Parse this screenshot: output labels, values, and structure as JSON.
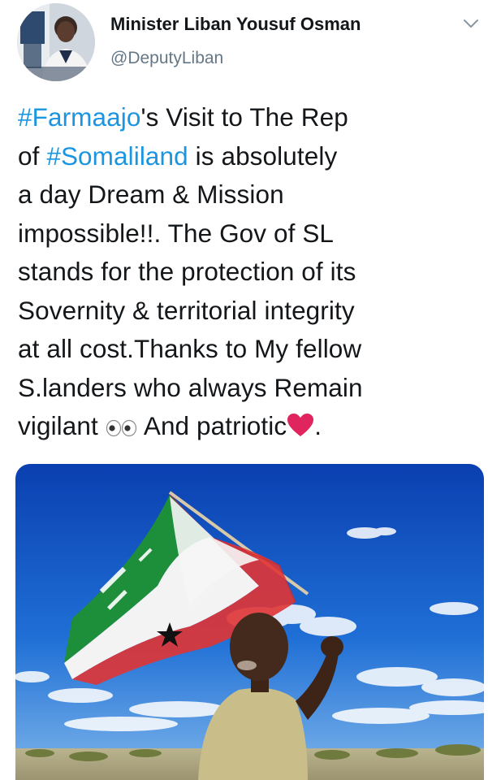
{
  "author": {
    "display_name": "Minister Liban Yousuf Osman",
    "handle": "@DeputyLiban",
    "avatar_icon": "avatar-photo",
    "menu_icon": "chevron-down-icon"
  },
  "tweet": {
    "lines": [
      [
        {
          "type": "hashtag",
          "text": "#Farmaajo"
        },
        {
          "type": "text",
          "text": "'s Visit to The Rep"
        }
      ],
      [
        {
          "type": "text",
          "text": "of "
        },
        {
          "type": "hashtag",
          "text": "#Somaliland"
        },
        {
          "type": "text",
          "text": " is absolutely"
        }
      ],
      [
        {
          "type": "text",
          "text": "a day Dream & Mission"
        }
      ],
      [
        {
          "type": "text",
          "text": "impossible!!. The  Gov of SL"
        }
      ],
      [
        {
          "type": "text",
          "text": "stands for the protection of its"
        }
      ],
      [
        {
          "type": "text",
          "text": "Sovernity & territorial integrity"
        }
      ],
      [
        {
          "type": "text",
          "text": "at all cost.Thanks to My fellow"
        }
      ],
      [
        {
          "type": "text",
          "text": "S.landers who always Remain"
        }
      ],
      [
        {
          "type": "text",
          "text": "vigilant "
        },
        {
          "type": "emoji",
          "name": "eyes-emoji"
        },
        {
          "type": "text",
          "text": " And patriotic"
        },
        {
          "type": "emoji",
          "name": "red-heart-emoji"
        },
        {
          "type": "text",
          "text": "."
        }
      ]
    ]
  },
  "media": {
    "description_icon": "photo-child-waving-somaliland-flag"
  },
  "colors": {
    "text": "#14171a",
    "secondary": "#657786",
    "hashtag": "#1b95e0",
    "heart": "#e0245e"
  }
}
